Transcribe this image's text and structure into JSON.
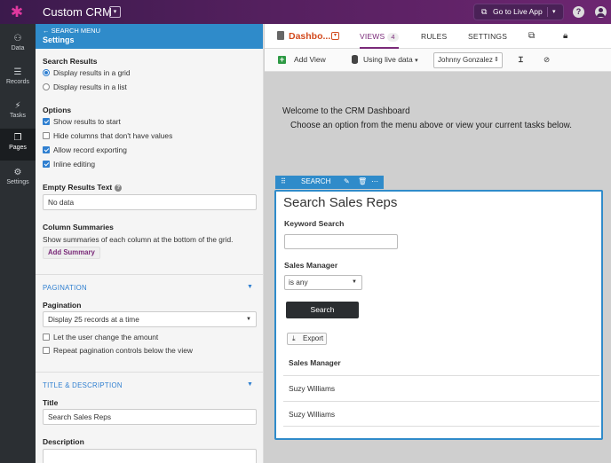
{
  "app": {
    "title": "Custom CRM",
    "live_button": "Go to Live App"
  },
  "rail": [
    {
      "label": "Data",
      "icon": "data-icon"
    },
    {
      "label": "Records",
      "icon": "records-icon"
    },
    {
      "label": "Tasks",
      "icon": "tasks-icon"
    },
    {
      "label": "Pages",
      "icon": "pages-icon"
    },
    {
      "label": "Settings",
      "icon": "settings-icon"
    }
  ],
  "panel": {
    "back": "SEARCH MENU",
    "title": "Settings",
    "search_results": {
      "heading": "Search Results",
      "options": [
        "Display results in a grid",
        "Display results in a list"
      ]
    },
    "options": {
      "heading": "Options",
      "items": [
        "Show results to start",
        "Hide columns that don't have values",
        "Allow record exporting",
        "Inline editing"
      ]
    },
    "empty": {
      "heading": "Empty Results Text",
      "value": "No data"
    },
    "summaries": {
      "heading": "Column Summaries",
      "desc": "Show summaries of each column at the bottom of the grid.",
      "button": "Add Summary"
    },
    "pagination": {
      "section": "PAGINATION",
      "heading": "Pagination",
      "value": "Display 25 records at a time",
      "items": [
        "Let the user change the amount",
        "Repeat pagination controls below the view"
      ]
    },
    "title_desc": {
      "section": "TITLE & DESCRIPTION",
      "title_label": "Title",
      "title_value": "Search Sales Reps",
      "desc_label": "Description"
    }
  },
  "header": {
    "page_name": "Dashbo...",
    "tabs": {
      "views": "VIEWS",
      "views_count": "4",
      "rules": "RULES",
      "settings": "SETTINGS"
    }
  },
  "toolbar": {
    "add_view": "Add View",
    "live_data": "Using live data",
    "user": "Johnny Gonzalez"
  },
  "canvas": {
    "welcome": "Welcome to the CRM Dashboard",
    "subtitle": "Choose an option from the menu above or view your current tasks below."
  },
  "widget": {
    "bar_label": "SEARCH",
    "title": "Search Sales Reps",
    "keyword_label": "Keyword Search",
    "manager_label": "Sales Manager",
    "manager_value": "is any",
    "search_button": "Search",
    "export_button": "Export",
    "column_header": "Sales Manager",
    "rows": [
      "Suzy Williams",
      "Suzy Williams"
    ]
  },
  "colors": {
    "accent": "#7a2a79",
    "panel_header": "#2f8bca",
    "page_name": "#d24a1e"
  }
}
